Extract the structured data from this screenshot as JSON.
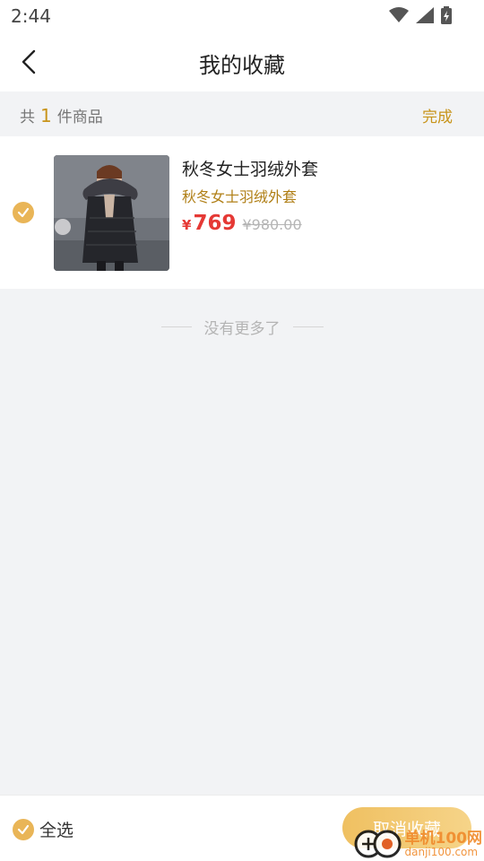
{
  "status_bar": {
    "time": "2:44",
    "icons": [
      "wifi-icon",
      "cellular-signal-icon",
      "battery-charging-icon"
    ]
  },
  "header": {
    "title": "我的收藏",
    "back_icon": "chevron-left-icon"
  },
  "summary": {
    "prefix": "共",
    "count": "1",
    "suffix": "件商品",
    "done_label": "完成"
  },
  "items": [
    {
      "name": "秋冬女士羽绒外套",
      "subtitle": "秋冬女士羽绒外套",
      "currency": "¥",
      "price": "769",
      "original_price": "¥980.00",
      "selected": true
    }
  ],
  "list_end_text": "没有更多了",
  "footer": {
    "select_all_label": "全选",
    "cancel_favorite_label": "取消收藏"
  },
  "watermark": {
    "line1": "单机100网",
    "line2": "danji100.com"
  },
  "colors": {
    "accent": "#e9b557",
    "accent_text": "#c8941a",
    "price": "#e53935",
    "background": "#f2f3f5"
  }
}
